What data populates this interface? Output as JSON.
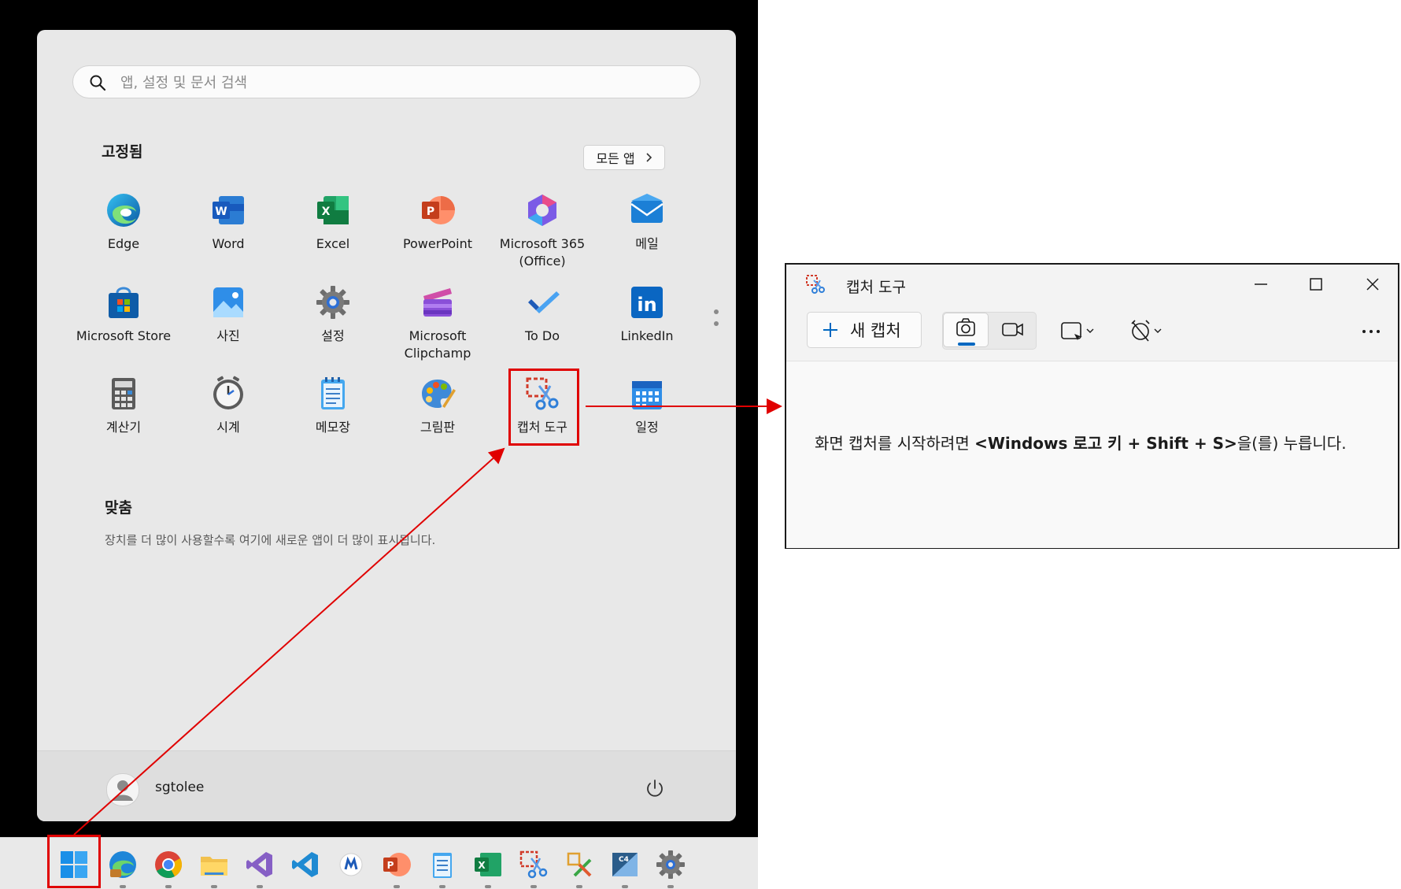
{
  "start_menu": {
    "search_placeholder": "앱, 설정 및 문서 검색",
    "pinned_title": "고정됨",
    "all_apps_label": "모든 앱",
    "pinned": [
      {
        "label": "Edge",
        "icon": "edge-icon"
      },
      {
        "label": "Word",
        "icon": "word-icon"
      },
      {
        "label": "Excel",
        "icon": "excel-icon"
      },
      {
        "label": "PowerPoint",
        "icon": "powerpoint-icon"
      },
      {
        "label": "Microsoft 365 (Office)",
        "icon": "microsoft365-icon"
      },
      {
        "label": "메일",
        "icon": "mail-icon"
      },
      {
        "label": "Microsoft Store",
        "icon": "store-icon"
      },
      {
        "label": "사진",
        "icon": "photos-icon"
      },
      {
        "label": "설정",
        "icon": "settings-icon"
      },
      {
        "label": "Microsoft Clipchamp",
        "icon": "clipchamp-icon"
      },
      {
        "label": "To Do",
        "icon": "todo-icon"
      },
      {
        "label": "LinkedIn",
        "icon": "linkedin-icon"
      },
      {
        "label": "계산기",
        "icon": "calculator-icon"
      },
      {
        "label": "시계",
        "icon": "clock-icon"
      },
      {
        "label": "메모장",
        "icon": "notepad-icon"
      },
      {
        "label": "그림판",
        "icon": "paint-icon"
      },
      {
        "label": "캡처 도구",
        "icon": "snipping-tool-icon"
      },
      {
        "label": "일정",
        "icon": "calendar-icon"
      }
    ],
    "recommended_title": "맞춤",
    "recommended_text": "장치를 더 많이 사용할수록 여기에 새로운 앱이 더 많이 표시됩니다.",
    "user_name": "sgtolee"
  },
  "taskbar": {
    "items": [
      "start-icon",
      "edge-icon",
      "chrome-icon",
      "file-explorer-icon",
      "visual-studio-icon",
      "vscode-icon",
      "app-icon",
      "powerpoint-icon",
      "notepad-icon",
      "excel-icon",
      "snipping-tool-icon",
      "tool-icon",
      "game-icon",
      "settings-icon"
    ]
  },
  "snipping_tool": {
    "title": "캡처 도구",
    "new_capture_label": "새 캡처",
    "message_prefix": "화면 캡처를 시작하려면 ",
    "message_shortcut": "<Windows 로고 키 + Shift + S>",
    "message_suffix": "을(를) 누릅니다."
  },
  "colors": {
    "highlight": "#e00000",
    "accent": "#0067c0"
  }
}
